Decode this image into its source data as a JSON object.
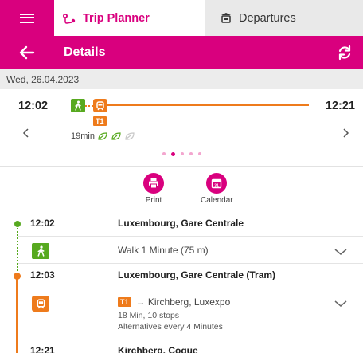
{
  "tabs": {
    "planner": {
      "label": "Trip Planner",
      "icon": "route-icon"
    },
    "departures": {
      "label": "Departures",
      "icon": "bus-stop-icon"
    }
  },
  "header": {
    "title": "Details"
  },
  "date": "Wed, 26.04.2023",
  "summary": {
    "departure": "12:02",
    "arrival": "12:21",
    "line": "T1",
    "duration": "19min"
  },
  "actions": {
    "print": "Print",
    "calendar": "Calendar",
    "calendar_day": "31"
  },
  "itinerary": {
    "stop1": {
      "time": "12:02",
      "name": "Luxembourg, Gare Centrale"
    },
    "walk": {
      "text": "Walk 1 Minute (75 m)"
    },
    "stop2": {
      "time": "12:03",
      "name": "Luxembourg, Gare Centrale (Tram)"
    },
    "tram": {
      "line": "T1",
      "arrow": "→",
      "destination": "Kirchberg, Luxexpo",
      "info": "18 Min, 10 stops",
      "frequency": "Alternatives every 4 Minutes"
    },
    "stop3": {
      "time": "12:21",
      "name": "Kirchberg, Coque"
    }
  },
  "colors": {
    "brand": "#d9007e",
    "tram": "#ee7b1c",
    "walk": "#57a91f"
  }
}
